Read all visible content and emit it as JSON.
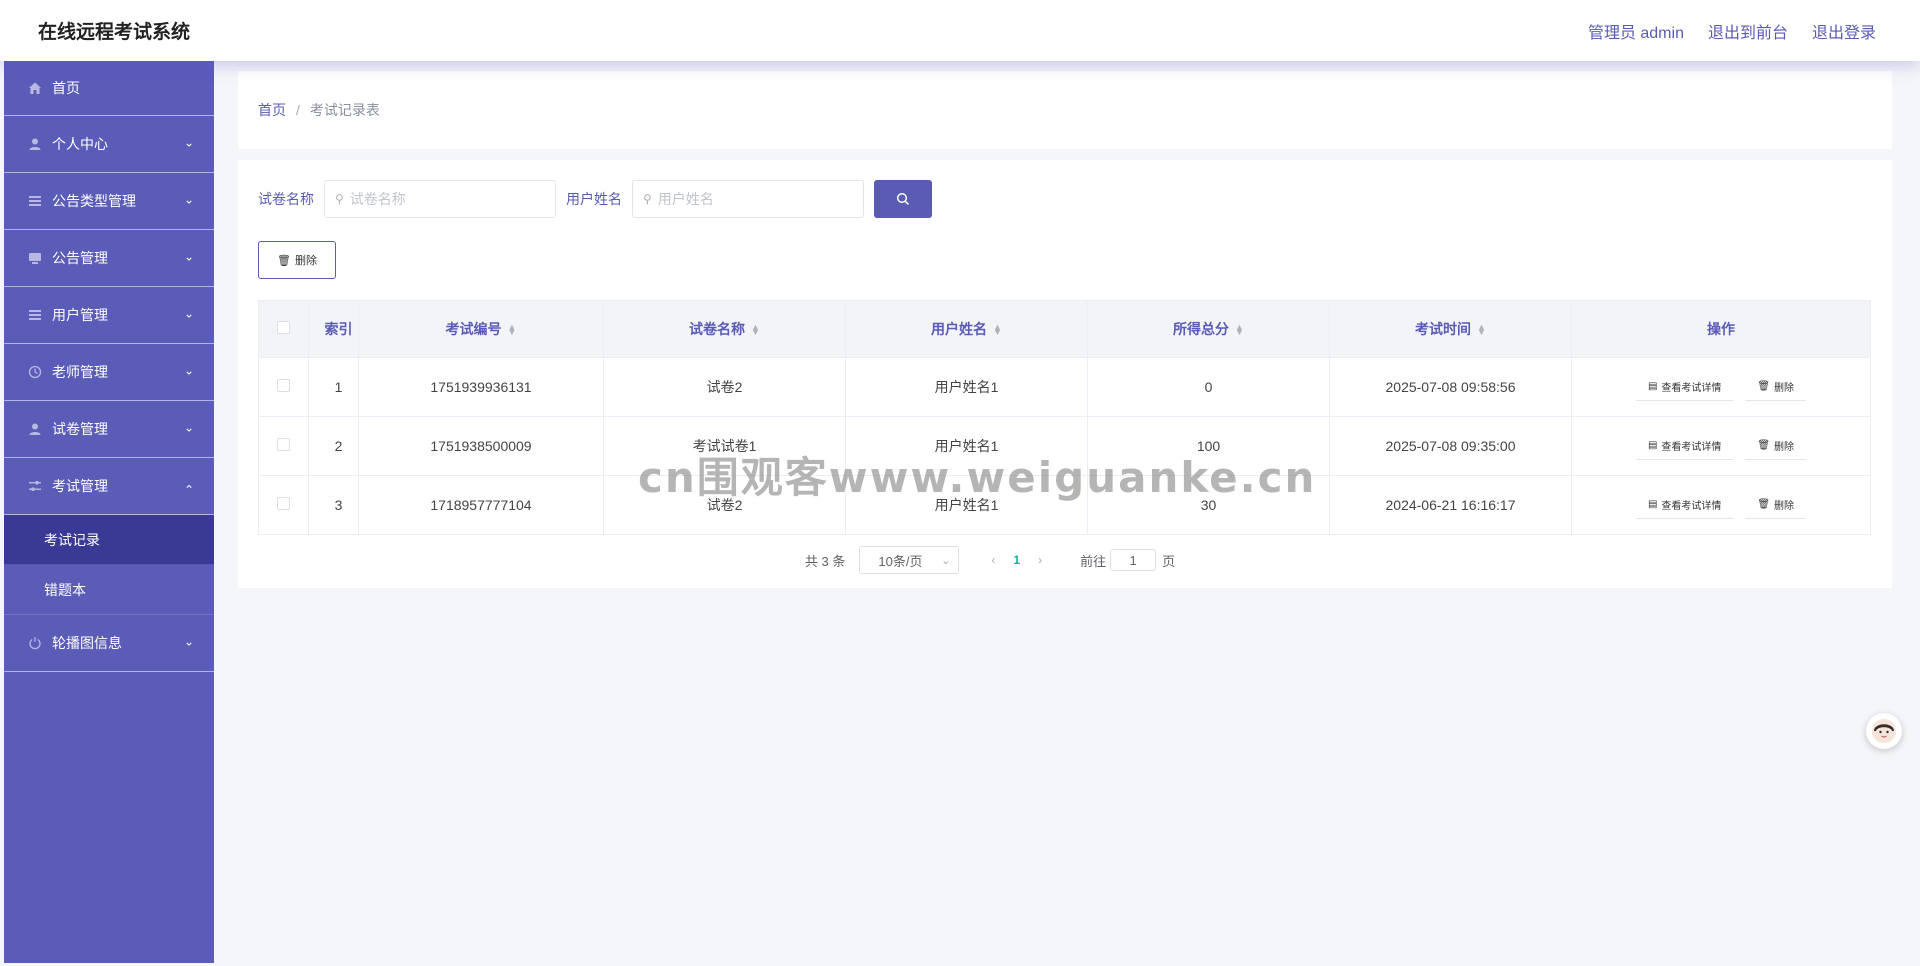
{
  "header": {
    "title": "在线远程考试系统",
    "admin_label": "管理员 admin",
    "exit_front_label": "退出到前台",
    "logout_label": "退出登录"
  },
  "sidebar": {
    "items": [
      {
        "label": "首页",
        "icon": "home-icon"
      },
      {
        "label": "个人中心",
        "icon": "user-icon"
      },
      {
        "label": "公告类型管理",
        "icon": "list-icon"
      },
      {
        "label": "公告管理",
        "icon": "monitor-icon"
      },
      {
        "label": "用户管理",
        "icon": "list-icon"
      },
      {
        "label": "老师管理",
        "icon": "clock-icon"
      },
      {
        "label": "试卷管理",
        "icon": "user-icon"
      },
      {
        "label": "考试管理",
        "icon": "settings-sliders-icon"
      }
    ],
    "submenu": [
      {
        "label": "考试记录"
      },
      {
        "label": "错题本"
      }
    ],
    "last_item": {
      "label": "轮播图信息",
      "icon": "power-icon"
    }
  },
  "breadcrumb": {
    "home": "首页",
    "separator": "/",
    "current": "考试记录表"
  },
  "search": {
    "paper_label": "试卷名称",
    "paper_placeholder": "试卷名称",
    "user_label": "用户姓名",
    "user_placeholder": "用户姓名"
  },
  "toolbar": {
    "delete_label": "删除"
  },
  "table": {
    "headers": [
      "索引",
      "考试编号",
      "试卷名称",
      "用户姓名",
      "所得总分",
      "考试时间",
      "操作"
    ],
    "rows": [
      {
        "index": "1",
        "exam_no": "1751939936131",
        "paper": "试卷2",
        "user": "用户姓名1",
        "score": "0",
        "time": "2025-07-08 09:58:56"
      },
      {
        "index": "2",
        "exam_no": "1751938500009",
        "paper": "考试试卷1",
        "user": "用户姓名1",
        "score": "100",
        "time": "2025-07-08 09:35:00"
      },
      {
        "index": "3",
        "exam_no": "1718957777104",
        "paper": "试卷2",
        "user": "用户姓名1",
        "score": "30",
        "time": "2024-06-21 16:16:17"
      }
    ],
    "view_label": "查看考试详情",
    "row_delete_label": "删除"
  },
  "pagination": {
    "total": "共 3 条",
    "page_size": "10条/页",
    "current_page": "1",
    "goto_label": "前往",
    "goto_value": "1",
    "page_suffix": "页"
  },
  "watermark": "cn围观客www.weiguanke.cn",
  "colors": {
    "accent": "#5a5bb5",
    "sidebar_bg": "#5b5bb8",
    "sidebar_active": "#3a3a94",
    "page_active": "#1aae9a"
  }
}
